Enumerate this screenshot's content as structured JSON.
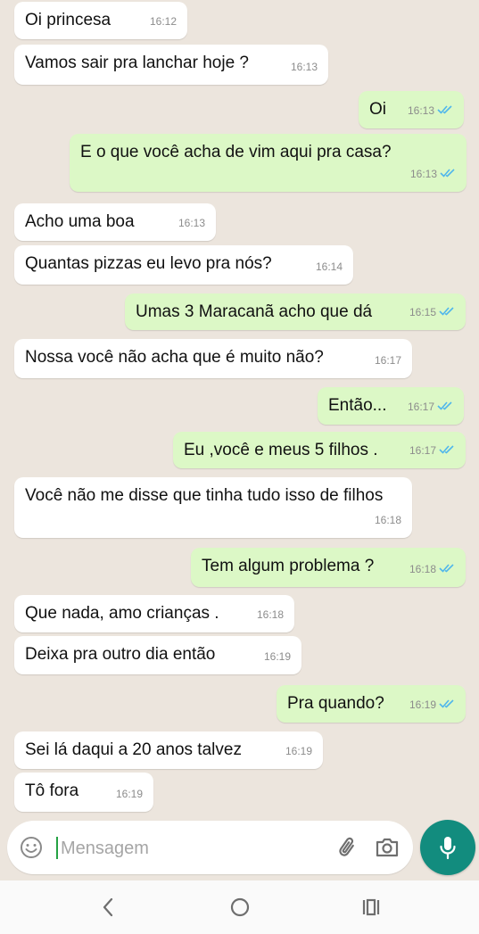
{
  "messages": [
    {
      "dir": "in",
      "text": "Oi princesa",
      "time": "16:12"
    },
    {
      "dir": "in",
      "text": "Vamos sair pra lanchar hoje ?",
      "time": "16:13"
    },
    {
      "dir": "out",
      "text": "Oi",
      "time": "16:13"
    },
    {
      "dir": "out",
      "text": "E o que você acha de vim aqui pra casa?",
      "time": "16:13"
    },
    {
      "dir": "in",
      "text": "Acho uma boa",
      "time": "16:13"
    },
    {
      "dir": "in",
      "text": "Quantas pizzas eu levo pra nós?",
      "time": "16:14"
    },
    {
      "dir": "out",
      "text": "Umas 3 Maracanã acho que dá",
      "time": "16:15"
    },
    {
      "dir": "in",
      "text": "Nossa você não acha que é muito não?",
      "time": "16:17"
    },
    {
      "dir": "out",
      "text": "Então...",
      "time": "16:17"
    },
    {
      "dir": "out",
      "text": "Eu ,você e meus 5 filhos .",
      "time": "16:17"
    },
    {
      "dir": "in",
      "text": "Você não me disse que tinha tudo isso de filhos",
      "time": "16:18"
    },
    {
      "dir": "out",
      "text": "Tem algum problema ?",
      "time": "16:18"
    },
    {
      "dir": "in",
      "text": "Que nada, amo crianças .",
      "time": "16:18"
    },
    {
      "dir": "in",
      "text": "Deixa pra outro dia então",
      "time": "16:19"
    },
    {
      "dir": "out",
      "text": "Pra quando?",
      "time": "16:19"
    },
    {
      "dir": "in",
      "text": "Sei lá daqui a 20 anos talvez",
      "time": "16:19"
    },
    {
      "dir": "in",
      "text": "Tô fora",
      "time": "16:19"
    }
  ],
  "input": {
    "placeholder": "Mensagem"
  },
  "icons": {
    "emoji": "emoji-icon",
    "attach": "paperclip-icon",
    "camera": "camera-icon",
    "mic": "microphone-icon",
    "read": "double-check-icon",
    "nav_back": "back-icon",
    "nav_home": "home-icon",
    "nav_recents": "recents-icon"
  },
  "colors": {
    "incoming": "#ffffff",
    "outgoing": "#dcf8c6",
    "background": "#ece5dd",
    "accent": "#128c7e",
    "read_ticks": "#4fb6ec"
  }
}
